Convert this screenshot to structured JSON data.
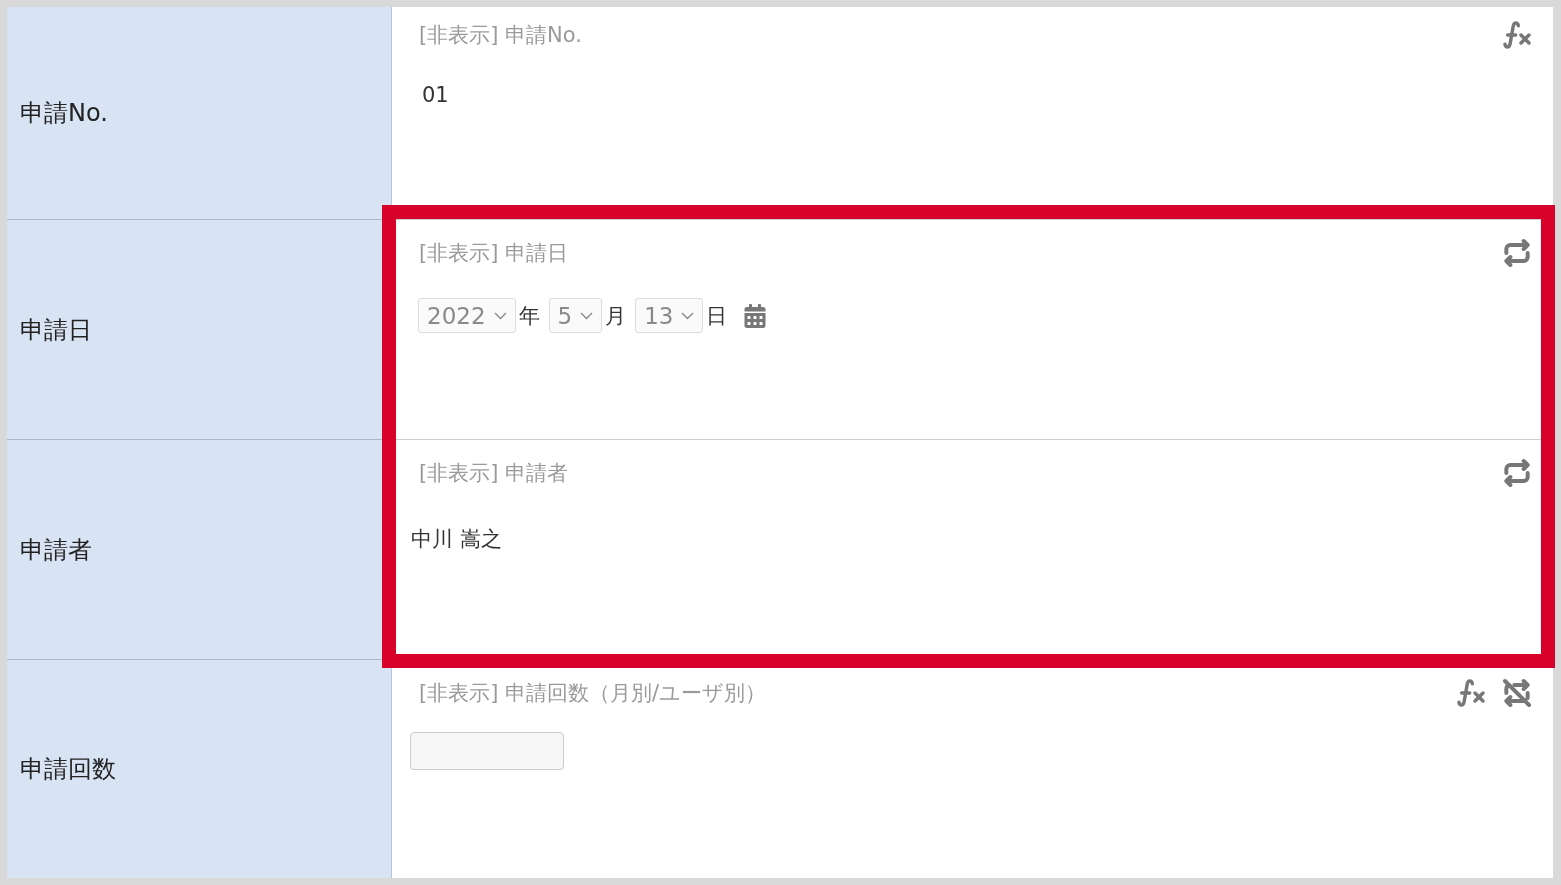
{
  "rows": [
    {
      "label": "申請No.",
      "field_title": "[非表示] 申請No.",
      "formula": true,
      "sync": false,
      "sync_off": false,
      "highlighted": false,
      "value": {
        "kind": "text",
        "text": "01"
      }
    },
    {
      "label": "申請日",
      "field_title": "[非表示] 申請日",
      "formula": false,
      "sync": true,
      "sync_off": false,
      "highlighted": true,
      "value": {
        "kind": "date",
        "parts": [
          {
            "value": "2022",
            "unit": "年"
          },
          {
            "value": "5",
            "unit": "月"
          },
          {
            "value": "13",
            "unit": "日"
          }
        ]
      }
    },
    {
      "label": "申請者",
      "field_title": "[非表示] 申請者",
      "formula": false,
      "sync": true,
      "sync_off": false,
      "highlighted": true,
      "value": {
        "kind": "user",
        "text": "中川 嵩之"
      }
    },
    {
      "label": "申請回数",
      "field_title": "[非表示] 申請回数（月別/ユーザ別）",
      "formula": true,
      "sync": false,
      "sync_off": true,
      "highlighted": false,
      "value": {
        "kind": "number"
      }
    }
  ]
}
